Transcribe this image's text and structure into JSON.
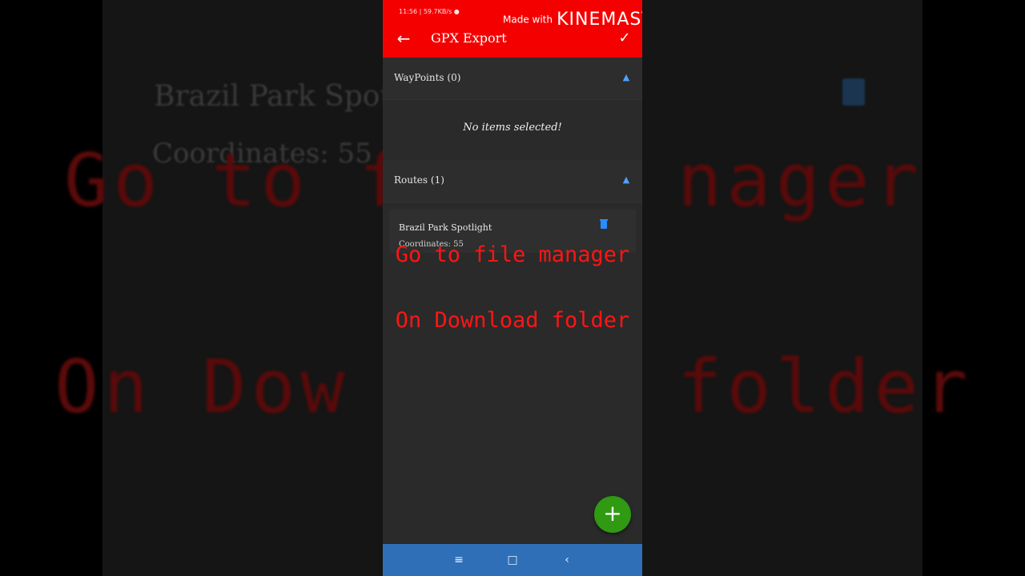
{
  "background": {
    "route_name": "Brazil Park Spotl",
    "coordinates": "Coordinates: 55",
    "caption1": "Go to f",
    "caption1_right": "nager",
    "caption2": "On Dow",
    "caption2_right": "folder"
  },
  "status_bar": {
    "text": "11:56 | 59.7KB/s ●"
  },
  "watermark": {
    "made_with": "Made with",
    "brand": "KINEMASTER"
  },
  "appbar": {
    "title": "GPX Export",
    "back_icon": "arrow-back-icon",
    "confirm_icon": "check-icon",
    "color": "#f40000"
  },
  "waypoints": {
    "label": "WayPoints (0)",
    "empty_text": "No items selected!"
  },
  "routes": {
    "label": "Routes (1)",
    "items": [
      {
        "name": "Brazil Park Spotlight",
        "coordinates": "Coordinates: 55"
      }
    ]
  },
  "captions": {
    "line1": "Go to file manager",
    "line2": "On Download folder",
    "color": "#ff1515"
  },
  "fab": {
    "label": "+",
    "icon": "add-icon",
    "color": "#2f9a12"
  },
  "navbar": {
    "recent": "≡",
    "home": "□",
    "back": "‹",
    "color": "#2f6fb8"
  }
}
